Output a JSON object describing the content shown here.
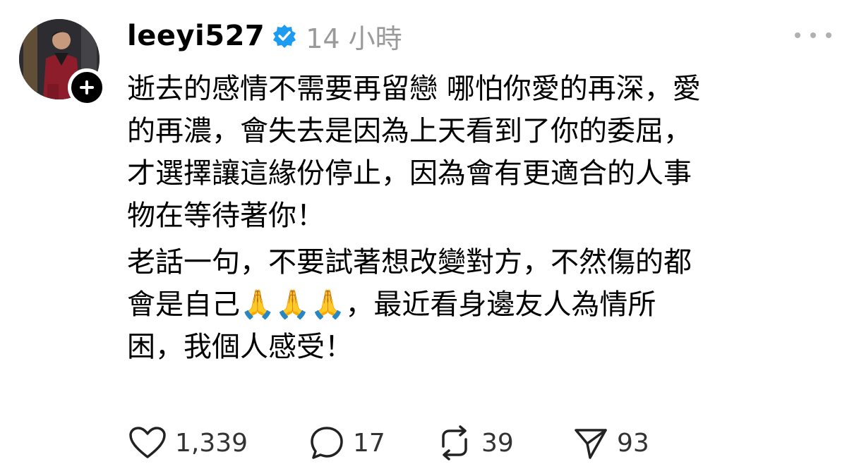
{
  "post": {
    "username": "leeyi527",
    "timestamp": "14 小時",
    "paragraphs": [
      "逝去的感情不需要再留戀 哪怕你愛的再深，愛\n的再濃，會失去是因為上天看到了你的委屈，\n才選擇讓這緣份停止，因為會有更適合的人事\n物在等待著你！",
      "老話一句，不要試著想改變對方，不然傷的都\n會是自己🙏🙏🙏，最近看身邊友人為情所\n困，我個人感受！"
    ],
    "actions": {
      "likes": "1,339",
      "replies": "17",
      "reposts": "39",
      "shares": "93"
    }
  },
  "colors": {
    "verified": "#1d9bf0",
    "timestamp": "#9a9a9a",
    "text": "#000000"
  },
  "icons": {
    "verified": "verified-badge-icon",
    "follow": "plus-icon",
    "more": "more-horizontal-icon",
    "like": "heart-icon",
    "reply": "speech-bubble-icon",
    "repost": "repost-icon",
    "share": "send-icon"
  }
}
